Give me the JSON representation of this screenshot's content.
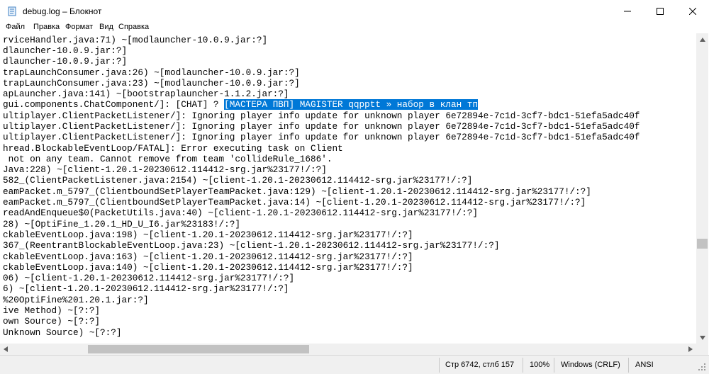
{
  "window": {
    "title": "debug.log – Блокнот",
    "app_icon": "notepad-icon",
    "controls": [
      "minimize-icon",
      "maximize-icon",
      "close-icon"
    ]
  },
  "menu": [
    "Файл",
    "Правка",
    "Формат",
    "Вид",
    "Справка"
  ],
  "editor": {
    "lines": [
      "rviceHandler.java:71) ~[modlauncher-10.0.9.jar:?]",
      "dlauncher-10.0.9.jar:?]",
      "dlauncher-10.0.9.jar:?]",
      "trapLaunchConsumer.java:26) ~[modlauncher-10.0.9.jar:?]",
      "trapLaunchConsumer.java:23) ~[modlauncher-10.0.9.jar:?]",
      "apLauncher.java:141) ~[bootstraplauncher-1.1.2.jar:?]",
      "gui.components.ChatComponent/]: [CHAT] ? ",
      "ultiplayer.ClientPacketListener/]: Ignoring player info update for unknown player 6e72894e-7c1d-3cf7-bdc1-51efa5adc40f",
      "ultiplayer.ClientPacketListener/]: Ignoring player info update for unknown player 6e72894e-7c1d-3cf7-bdc1-51efa5adc40f",
      "ultiplayer.ClientPacketListener/]: Ignoring player info update for unknown player 6e72894e-7c1d-3cf7-bdc1-51efa5adc40f",
      "hread.BlockableEventLoop/FATAL]: Error executing task on Client",
      " not on any team. Cannot remove from team 'collideRule_1686'.",
      "Java:228) ~[client-1.20.1-20230612.114412-srg.jar%23177!/:?]",
      "582_(ClientPacketListener.java:2154) ~[client-1.20.1-20230612.114412-srg.jar%23177!/:?]",
      "eamPacket.m_5797_(ClientboundSetPlayerTeamPacket.java:129) ~[client-1.20.1-20230612.114412-srg.jar%23177!/:?]",
      "eamPacket.m_5797_(ClientboundSetPlayerTeamPacket.java:14) ~[client-1.20.1-20230612.114412-srg.jar%23177!/:?]",
      "readAndEnqueue$0(PacketUtils.java:40) ~[client-1.20.1-20230612.114412-srg.jar%23177!/:?]",
      "28) ~[OptiFine_1.20.1_HD_U_I6.jar%23183!/:?]",
      "ckableEventLoop.java:198) ~[client-1.20.1-20230612.114412-srg.jar%23177!/:?]",
      "367_(ReentrantBlockableEventLoop.java:23) ~[client-1.20.1-20230612.114412-srg.jar%23177!/:?]",
      "ckableEventLoop.java:163) ~[client-1.20.1-20230612.114412-srg.jar%23177!/:?]",
      "ckableEventLoop.java:140) ~[client-1.20.1-20230612.114412-srg.jar%23177!/:?]",
      "06) ~[client-1.20.1-20230612.114412-srg.jar%23177!/:?]",
      "6) ~[client-1.20.1-20230612.114412-srg.jar%23177!/:?]",
      "%20OptiFine%201.20.1.jar:?]",
      "ive Method) ~[?:?]",
      "own Source) ~[?:?]",
      "Unknown Source) ~[?:?]"
    ],
    "selected_text": "[МАСТЕРА ПВП] MAGISTER qqpptt » набор в клан тп",
    "selection_color": "#0078d7"
  },
  "status": {
    "position": "Стр 6742, стлб 157",
    "zoom": "100%",
    "line_endings": "Windows (CRLF)",
    "encoding": "ANSI"
  }
}
